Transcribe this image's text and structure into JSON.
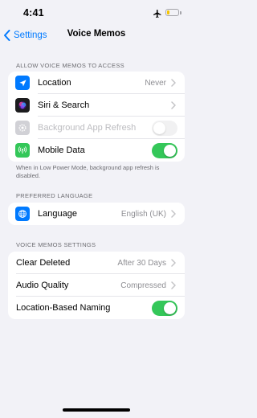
{
  "status_bar": {
    "time": "4:41"
  },
  "nav": {
    "back_label": "Settings",
    "title": "Voice Memos"
  },
  "access_section": {
    "header": "ALLOW VOICE MEMOS TO ACCESS",
    "rows": [
      {
        "label": "Location",
        "value": "Never",
        "icon": "location-arrow-icon",
        "icon_color": "#007aff"
      },
      {
        "label": "Siri & Search",
        "icon": "siri-icon",
        "icon_color": "#1c1c1e"
      },
      {
        "label": "Background App Refresh",
        "icon": "gear-icon",
        "icon_color": "#d1d1d6",
        "toggle": "off",
        "disabled": true
      },
      {
        "label": "Mobile Data",
        "icon": "antenna-icon",
        "icon_color": "#34c759",
        "toggle": "on"
      }
    ],
    "footer": "When in Low Power Mode, background app refresh is disabled."
  },
  "language_section": {
    "header": "PREFERRED LANGUAGE",
    "rows": [
      {
        "label": "Language",
        "value": "English (UK)",
        "icon": "globe-icon",
        "icon_color": "#007aff"
      }
    ]
  },
  "memos_section": {
    "header": "VOICE MEMOS SETTINGS",
    "rows": [
      {
        "label": "Clear Deleted",
        "value": "After 30 Days"
      },
      {
        "label": "Audio Quality",
        "value": "Compressed"
      },
      {
        "label": "Location-Based Naming",
        "toggle": "on"
      }
    ]
  },
  "colors": {
    "accent": "#007aff",
    "toggle_on": "#34c759",
    "background": "#f2f2f7"
  }
}
